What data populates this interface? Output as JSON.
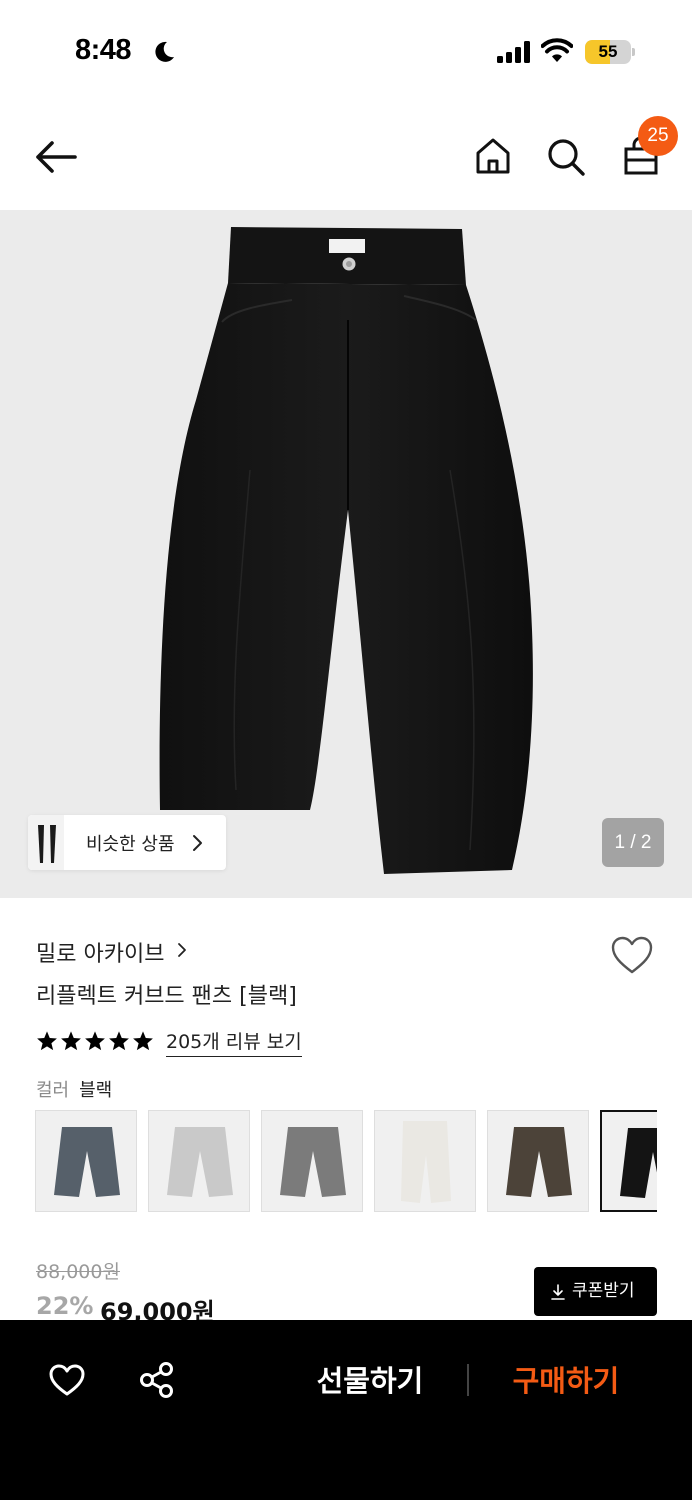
{
  "status_bar": {
    "time": "8:48",
    "battery": "55",
    "battery_level": 0.55,
    "icons": [
      "moon-icon",
      "signal-icon",
      "wifi-icon",
      "battery-icon"
    ]
  },
  "nav": {
    "icons": [
      "back-arrow-icon",
      "home-icon",
      "search-icon",
      "shopping-bag-icon"
    ],
    "cart_count": "25"
  },
  "hero": {
    "similar_label": "비슷한 상품",
    "page_indicator": "1 / 2",
    "current_page": 1,
    "total_pages": 2,
    "background": "#ebebeb"
  },
  "product": {
    "brand": "밀로 아카이브",
    "name": "리플렉트 커브드 팬츠 [블랙]",
    "rating_stars": 5,
    "review_link": "205개 리뷰 보기",
    "color_label": "컬러",
    "color_value": "블랙"
  },
  "swatches": [
    {
      "name": "vintage-blue",
      "color": "#56606a",
      "selected": false
    },
    {
      "name": "light-grey",
      "color": "#c9c9c9",
      "selected": false
    },
    {
      "name": "grey",
      "color": "#7b7b7b",
      "selected": false
    },
    {
      "name": "ivory",
      "color": "#eae8e3",
      "selected": false
    },
    {
      "name": "brown",
      "color": "#4c4339",
      "selected": false
    },
    {
      "name": "black",
      "color": "#141414",
      "selected": true
    }
  ],
  "price": {
    "original": "88,000원",
    "discount": "22%",
    "sale": "69,000원",
    "coupon_label": "쿠폰받기"
  },
  "bottom_bar": {
    "icons": [
      "heart-icon",
      "share-icon"
    ],
    "gift_label": "선물하기",
    "buy_label": "구매하기",
    "accent_color": "#f45b14"
  }
}
